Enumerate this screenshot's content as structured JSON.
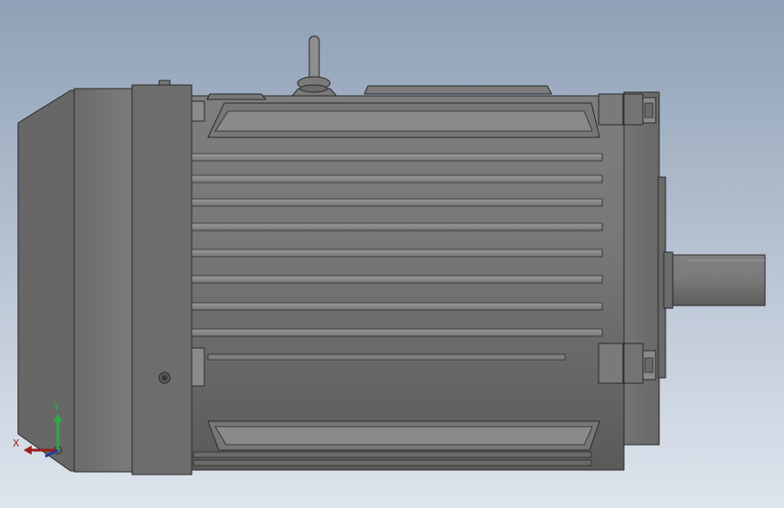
{
  "viewport": {
    "background_top": "#8fa0b6",
    "background_bottom": "#dfe5ee"
  },
  "triad": {
    "x_label": "X",
    "y_label": "Y",
    "x_color": "#9b1c1c",
    "y_color": "#2fa84a",
    "z_color": "#213e9c"
  },
  "model": {
    "body_color": "#6f6f6f",
    "edge_color": "#2a2a2a",
    "highlight_color": "#a8a8a8"
  }
}
